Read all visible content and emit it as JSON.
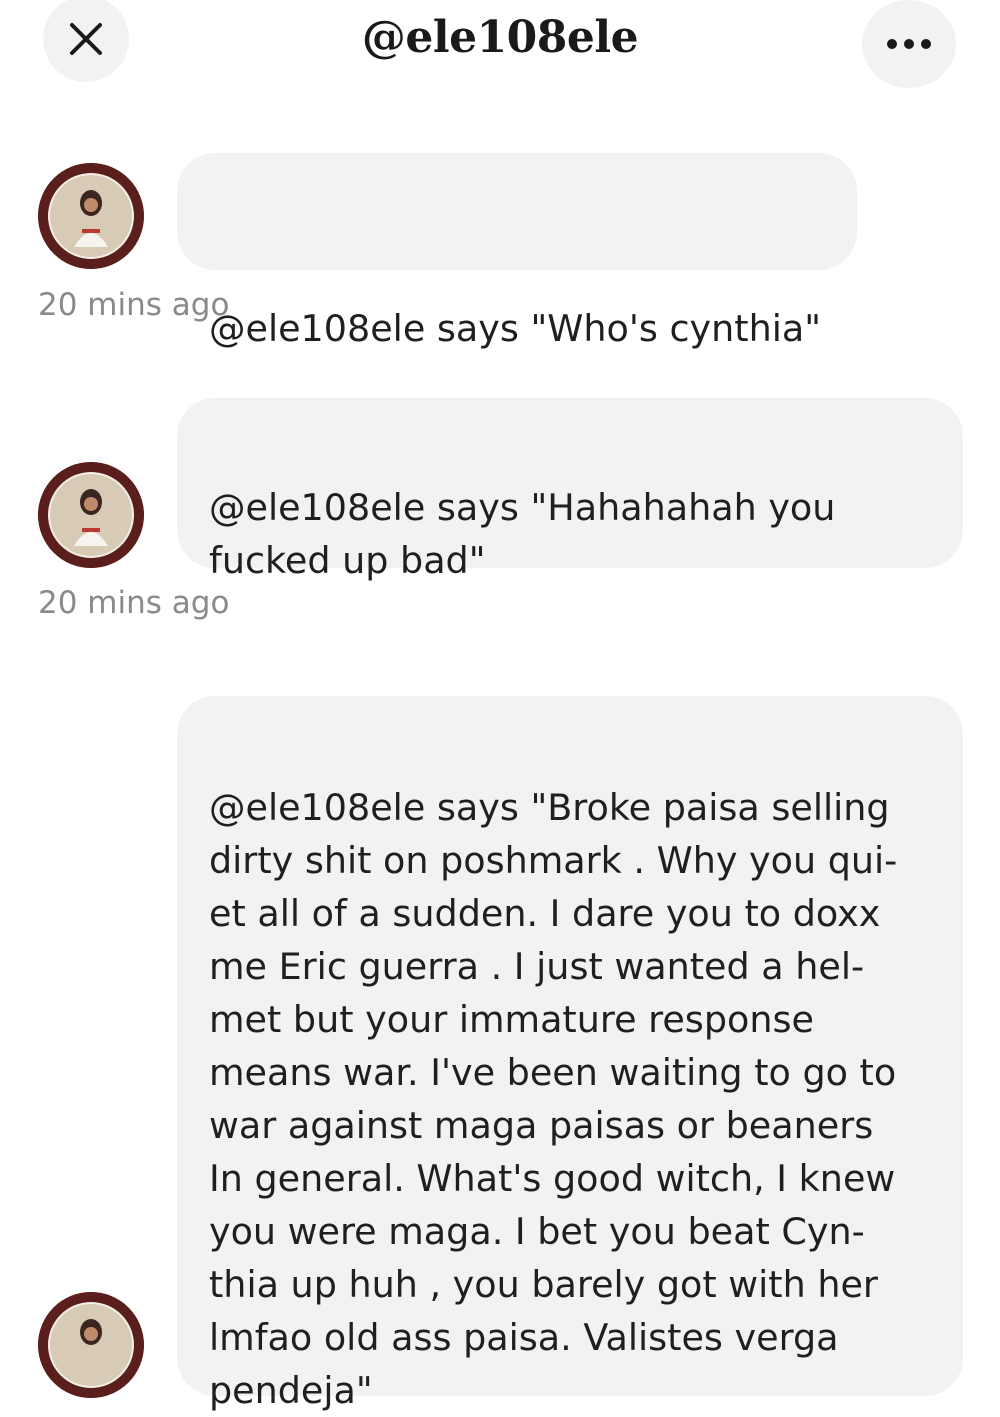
{
  "header": {
    "title": "@ele108ele",
    "close_icon": "close-icon",
    "more_icon": "more-horizontal-icon"
  },
  "messages": [
    {
      "text": "@ele108ele says \"Who's cynthia\"",
      "time": "20 mins ago",
      "avatar_icon": "user-avatar"
    },
    {
      "text": "@ele108ele says \"Hahahahah you\nfucked up bad\"",
      "time": "20 mins ago",
      "avatar_icon": "user-avatar"
    },
    {
      "text": "@ele108ele says \"Broke paisa selling\ndirty shit on poshmark . Why you qui-\net all of a sudden. I dare you to doxx\nme Eric guerra . I just wanted a hel-\nmet but your immature response\nmeans war. I've been waiting to go to\nwar against maga paisas or beaners\nIn general. What's good witch, I knew\nyou were maga. I bet you beat Cyn-\nthia up huh , you barely got with her\nlmfao old ass paisa. Valistes verga\npendeja\"",
      "avatar_icon": "user-avatar"
    }
  ],
  "colors": {
    "bubble": "#f2f2f2",
    "timestamp": "#8a8a8a",
    "avatar_ring": "#6b2322"
  }
}
